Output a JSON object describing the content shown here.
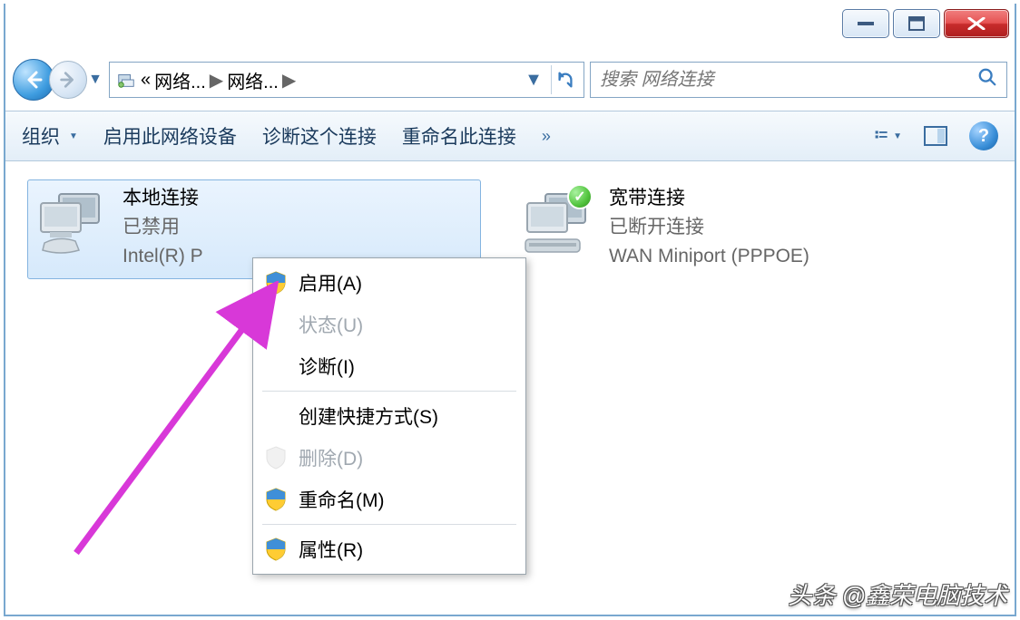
{
  "breadcrumb": {
    "chev_prefix": "«",
    "part1": "网络...",
    "part2": "网络..."
  },
  "search": {
    "placeholder": "搜索 网络连接"
  },
  "toolbar": {
    "organize": "组织",
    "enable_device": "启用此网络设备",
    "diagnose": "诊断这个连接",
    "rename": "重命名此连接",
    "overflow": "»"
  },
  "connections": [
    {
      "name": "本地连接",
      "status": "已禁用",
      "device": "Intel(R) P",
      "selected": true,
      "badge": null
    },
    {
      "name": "宽带连接",
      "status": "已断开连接",
      "device": "WAN Miniport (PPPOE)",
      "selected": false,
      "badge": "check"
    }
  ],
  "context_menu": {
    "enable": "启用(A)",
    "status": "状态(U)",
    "diagnose": "诊断(I)",
    "create_shortcut": "创建快捷方式(S)",
    "delete": "删除(D)",
    "rename": "重命名(M)",
    "properties": "属性(R)"
  },
  "watermark": "头条 @鑫荣电脑技术"
}
